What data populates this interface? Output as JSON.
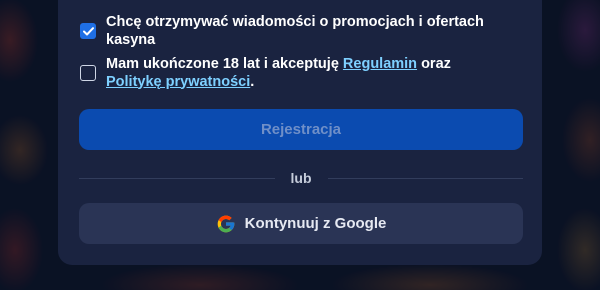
{
  "consent": {
    "marketing": {
      "checked": true,
      "label": "Chcę otrzymywać wiadomości o promocjach i ofertach kasyna"
    },
    "terms": {
      "checked": false,
      "text_before": "Mam ukończone 18 lat i akceptuję ",
      "terms_link": "Regulamin",
      "text_middle": " oraz ",
      "privacy_link": "Politykę prywatności",
      "text_after": "."
    }
  },
  "register_button": {
    "label": "Rejestracja",
    "color": "#0b4bb0"
  },
  "divider": {
    "label": "lub"
  },
  "google_button": {
    "label": "Kontynuuj z Google",
    "icon": "google-icon"
  },
  "colors": {
    "accent": "#1f6fe5",
    "link": "#7ed0ff",
    "panel": "#1a2340"
  }
}
